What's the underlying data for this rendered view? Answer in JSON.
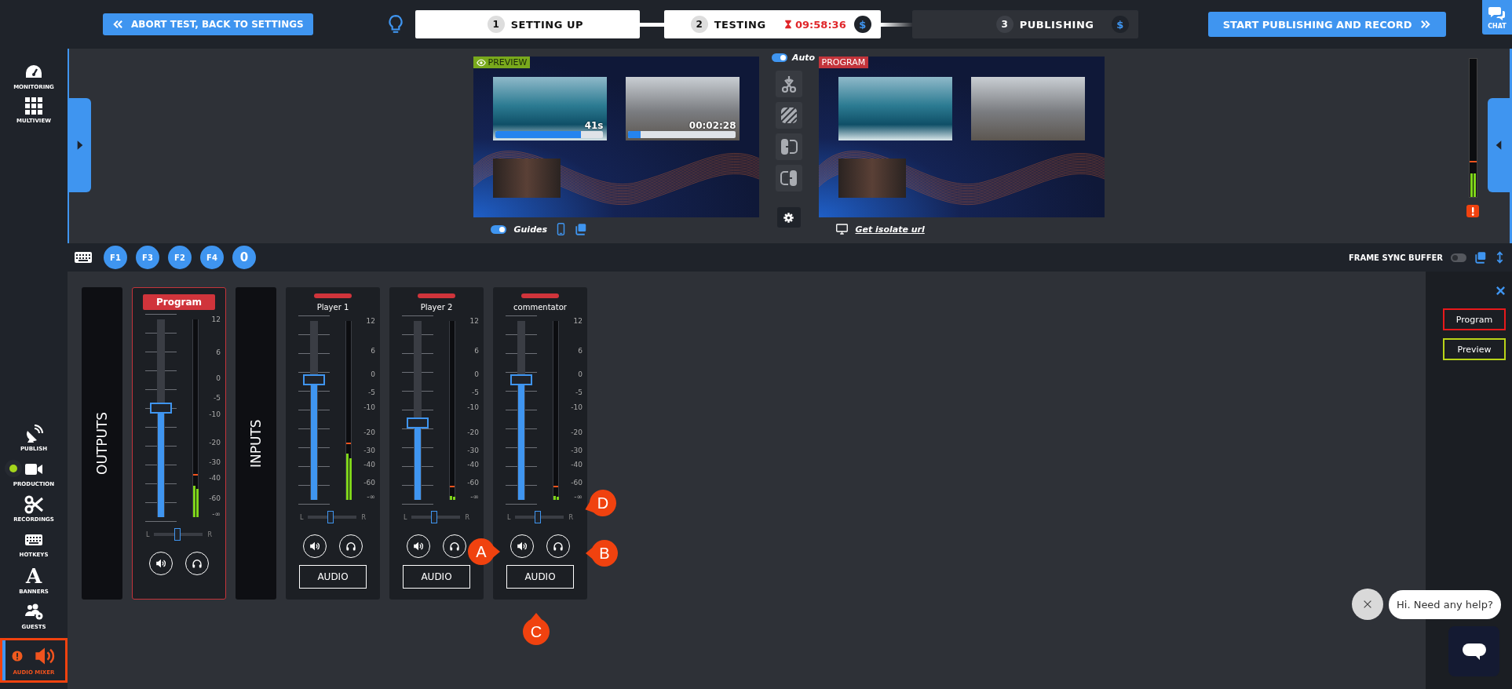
{
  "top_bar": {
    "abort_button": "ABORT TEST, BACK TO SETTINGS",
    "steps": [
      {
        "number": "1",
        "label": "SETTING UP",
        "reached": true
      },
      {
        "number": "2",
        "label": "TESTING",
        "reached": true,
        "timer": "09:58:36",
        "price_badge": "$"
      },
      {
        "number": "3",
        "label": "PUBLISHING",
        "reached": false,
        "price_badge": "$"
      }
    ],
    "start_button": "START PUBLISHING AND RECORD",
    "chat_button": "CHAT"
  },
  "sidebar": {
    "top_items": [
      {
        "label": "MONITORING"
      },
      {
        "label": "MULTIVIEW"
      }
    ],
    "bottom_items": [
      {
        "label": "PUBLISH",
        "live": false,
        "alert": false,
        "selected": false,
        "highlighted": false
      },
      {
        "label": "PRODUCTION",
        "live": true,
        "alert": false,
        "selected": false,
        "highlighted": false
      },
      {
        "label": "RECORDINGS",
        "live": false,
        "alert": false,
        "selected": false,
        "highlighted": false
      },
      {
        "label": "HOTKEYS",
        "live": false,
        "alert": false,
        "selected": false,
        "highlighted": false
      },
      {
        "label": "BANNERS",
        "icon_text": "A",
        "live": false,
        "alert": false,
        "selected": false,
        "highlighted": false
      },
      {
        "label": "GUESTS",
        "live": false,
        "alert": false,
        "selected": false,
        "highlighted": false
      },
      {
        "label": "AUDIO MIXER",
        "live": false,
        "alert": true,
        "selected": true,
        "highlighted": true
      }
    ]
  },
  "monitor": {
    "preview": {
      "badge": "PREVIEW",
      "clips": [
        {
          "time": "41s",
          "level": 0.8
        },
        {
          "time": "00:02:28",
          "level": 0.12
        }
      ]
    },
    "auto_switch": {
      "label": "Auto",
      "on": true
    },
    "program": {
      "badge": "PROGRAM"
    },
    "guides_switch": {
      "label": "Guides",
      "on": true
    },
    "isolate_link": "Get isolate url",
    "master_meter": {
      "level": 0.17
    }
  },
  "toolbar": {
    "hotkeys": [
      "F1",
      "F3",
      "F2",
      "F4",
      "0"
    ],
    "frame_sync": {
      "label": "FRAME SYNC BUFFER",
      "on": false
    }
  },
  "mixer": {
    "outputs_label": "OUTPUTS",
    "inputs_label": "INPUTS",
    "strips": [
      {
        "kind": "output",
        "title": "Program",
        "selected": true,
        "fader": {
          "level": 0.55
        },
        "meter": {
          "level": 0.16
        },
        "pan": {
          "level": 0.47
        },
        "pan_left": "L",
        "pan_right": "R",
        "scale": [
          "12",
          "6",
          "0",
          "-5",
          "-10",
          "-20",
          "-30",
          "-40",
          "-60",
          "-∞"
        ]
      },
      {
        "kind": "input",
        "title": "Player 1",
        "selected": false,
        "fader": {
          "level": 0.67
        },
        "meter": {
          "level": 0.26
        },
        "pan": {
          "level": 0.46
        },
        "pan_left": "L",
        "pan_right": "R",
        "scale": [
          "12",
          "6",
          "0",
          "-5",
          "-10",
          "-20",
          "-30",
          "-40",
          "-60",
          "-∞"
        ],
        "button": "AUDIO"
      },
      {
        "kind": "input",
        "title": "Player 2",
        "selected": false,
        "fader": {
          "level": 0.43
        },
        "meter": {
          "level": 0.02
        },
        "pan": {
          "level": 0.46
        },
        "pan_left": "L",
        "pan_right": "R",
        "scale": [
          "12",
          "6",
          "0",
          "-5",
          "-10",
          "-20",
          "-30",
          "-40",
          "-60",
          "-∞"
        ],
        "button": "AUDIO"
      },
      {
        "kind": "input",
        "title": "commentator",
        "selected": false,
        "fader": {
          "level": 0.67
        },
        "meter": {
          "level": 0.02
        },
        "pan": {
          "level": 0.46
        },
        "pan_left": "L",
        "pan_right": "R",
        "scale": [
          "12",
          "6",
          "0",
          "-5",
          "-10",
          "-20",
          "-30",
          "-40",
          "-60",
          "-∞"
        ],
        "button": "AUDIO"
      }
    ]
  },
  "assign_panel": {
    "buttons": [
      {
        "label": "Program",
        "color": "#e8191b"
      },
      {
        "label": "Preview",
        "color": "#b9d418"
      }
    ]
  },
  "callouts": [
    {
      "label": "A"
    },
    {
      "label": "B"
    },
    {
      "label": "C"
    },
    {
      "label": "D"
    }
  ],
  "chat_widget": {
    "message": "Hi. Need any help?"
  }
}
